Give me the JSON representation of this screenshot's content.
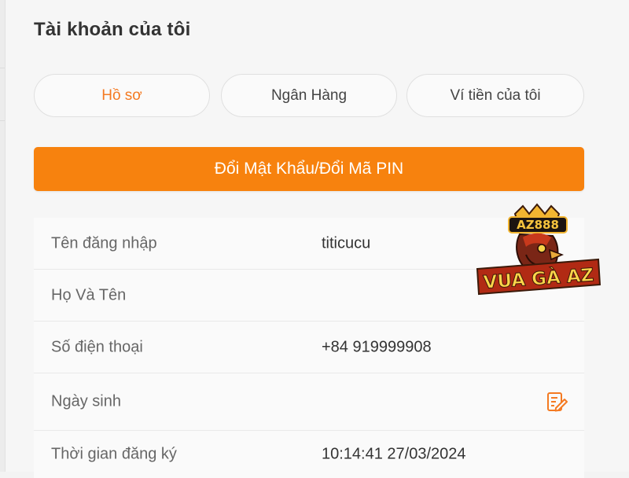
{
  "page": {
    "title": "Tài khoản của tôi"
  },
  "tabs": [
    {
      "label": "Hồ sơ",
      "active": true
    },
    {
      "label": "Ngân Hàng",
      "active": false
    },
    {
      "label": "Ví tiền của tôi",
      "active": false
    }
  ],
  "actions": {
    "change_password_label": "Đổi Mật Khẩu/Đổi Mã PIN"
  },
  "profile": {
    "rows": [
      {
        "label": "Tên đăng nhập",
        "value": "titicucu"
      },
      {
        "label": "Họ Và Tên",
        "value": ""
      },
      {
        "label": "Số điện thoại",
        "value": "+84 919999908"
      },
      {
        "label": "Ngày sinh",
        "value": "",
        "icon": "edit-note-icon"
      },
      {
        "label": "Thời gian đăng ký",
        "value": "10:14:41 27/03/2024"
      }
    ]
  },
  "logo": {
    "badge": "AZ888",
    "name": "VUA GÀ AZ"
  },
  "colors": {
    "accent": "#f7820e",
    "accent_text": "#f47a22",
    "background": "#f6f6f6",
    "card": "#fafafa"
  }
}
